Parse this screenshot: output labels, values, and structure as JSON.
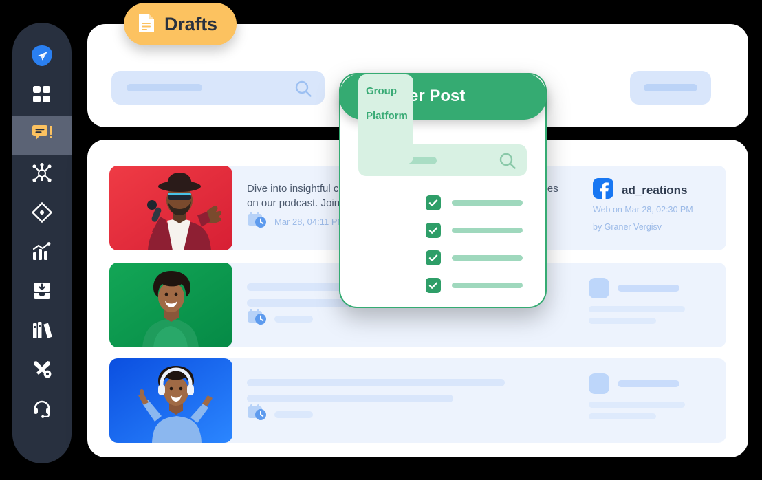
{
  "theme": {
    "sidebar_bg": "#28303f",
    "sidebar_active_bg": "#5b6375",
    "accent_green": "#35ab72",
    "accent_green_dark": "#2e9e68",
    "accent_yellow": "#fcc260",
    "skeleton_blue": "#d9e6fb",
    "row_bg": "#edf3fd",
    "muted_blue_text": "#9dbbe8",
    "card_white": "#ffffff",
    "page_bg": "#000000"
  },
  "sidebar": {
    "items": [
      {
        "id": "send",
        "icon": "paper-plane-icon",
        "active": false
      },
      {
        "id": "dashboard",
        "icon": "grid-dashboard-icon",
        "active": false
      },
      {
        "id": "posts",
        "icon": "comment-edit-icon",
        "active": true
      },
      {
        "id": "network",
        "icon": "network-nodes-icon",
        "active": false
      },
      {
        "id": "compass",
        "icon": "compass-diamond-icon",
        "active": false
      },
      {
        "id": "analytics",
        "icon": "bar-chart-trend-icon",
        "active": false
      },
      {
        "id": "inbox",
        "icon": "inbox-download-icon",
        "active": false
      },
      {
        "id": "library",
        "icon": "books-library-icon",
        "active": false
      },
      {
        "id": "tools",
        "icon": "tools-wrench-icon",
        "active": false
      },
      {
        "id": "support",
        "icon": "headset-support-icon",
        "active": false
      }
    ]
  },
  "drafts_tab": {
    "label": "Drafts",
    "icon": "document-icon"
  },
  "toolbar": {
    "search": {
      "placeholder": "",
      "value": "",
      "icon": "search-icon"
    },
    "action_button": {
      "label": ""
    }
  },
  "filter_panel": {
    "title": "Filter Post",
    "icon": "funnel-filter-icon",
    "search": {
      "placeholder": "",
      "value": "",
      "icon": "search-icon"
    },
    "tabs": [
      {
        "label": "Group",
        "selected": false
      },
      {
        "label": "Platform",
        "selected": false
      }
    ],
    "options": [
      {
        "label": "",
        "checked": true
      },
      {
        "label": "",
        "checked": true
      },
      {
        "label": "",
        "checked": true
      },
      {
        "label": "",
        "checked": true
      }
    ]
  },
  "posts": [
    {
      "thumb": {
        "name": "singer-red-background-photo",
        "bg": "#e8303f"
      },
      "text": "Dive into insightful conversations with industry leaders and creatives on our podcast. Join the discussion today.",
      "schedule": {
        "icon": "calendar-clock-icon",
        "time": "Mar 28, 04:11 PM"
      },
      "account": {
        "platform_icon": "facebook-icon",
        "name": "ad_reations",
        "source_line": "Web on Mar 28, 02:30 PM",
        "author_line": "by Graner Vergisv"
      }
    },
    {
      "thumb": {
        "name": "smiling-woman-green-background-photo",
        "bg": "#0a9d4f"
      },
      "text": "",
      "schedule": {
        "icon": "calendar-clock-icon",
        "time": ""
      },
      "account": {
        "platform_icon": "",
        "name": "",
        "source_line": "",
        "author_line": ""
      }
    },
    {
      "thumb": {
        "name": "dancing-woman-blue-background-photo",
        "bg": "#1461f0"
      },
      "text": "",
      "schedule": {
        "icon": "calendar-clock-icon",
        "time": ""
      },
      "account": {
        "platform_icon": "",
        "name": "",
        "source_line": "",
        "author_line": ""
      }
    }
  ]
}
